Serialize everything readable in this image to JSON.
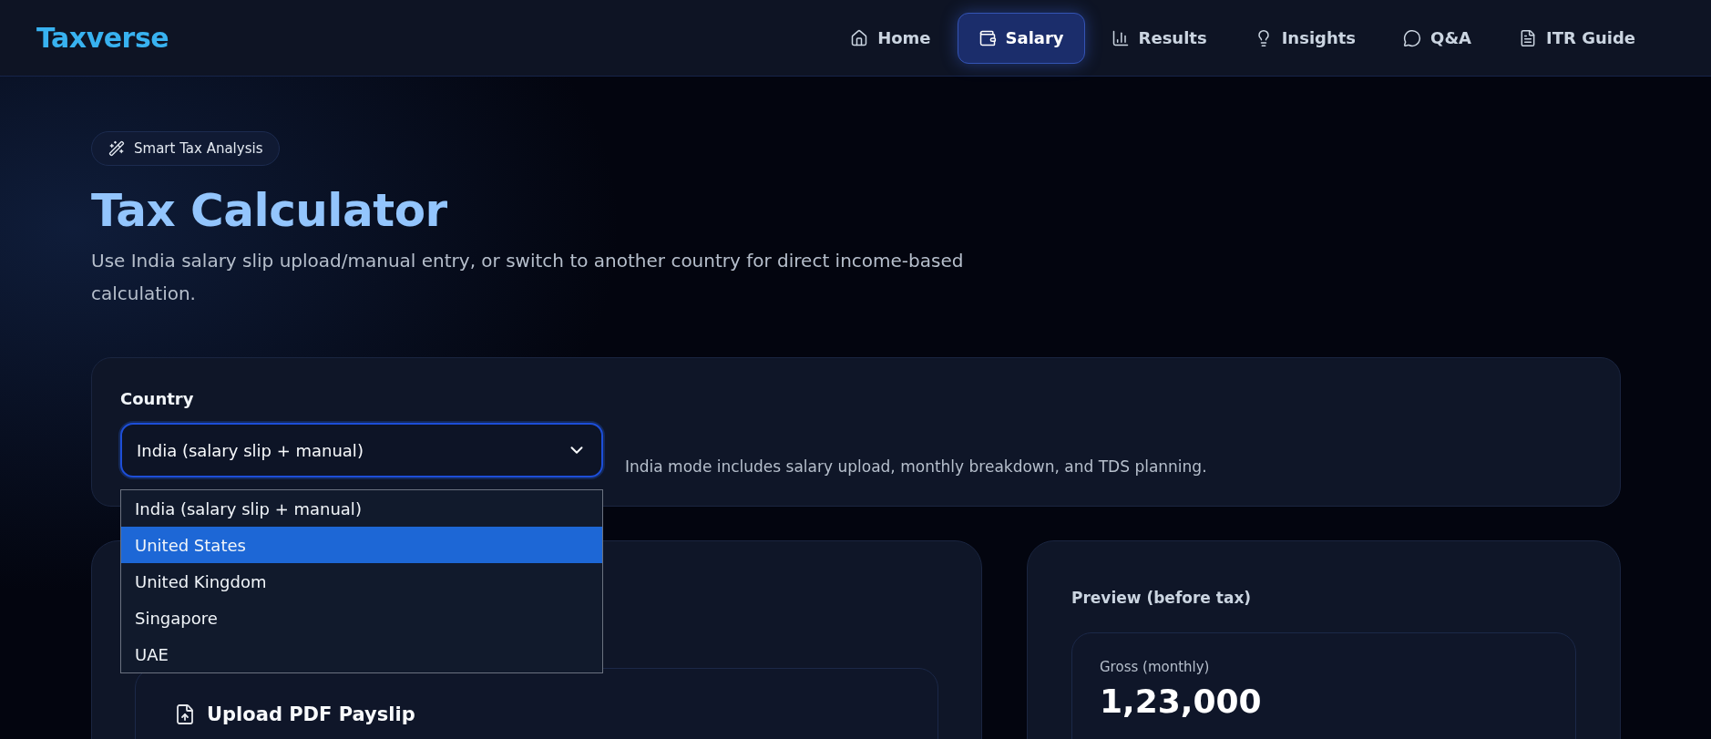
{
  "header": {
    "logo": "Taxverse",
    "nav": [
      {
        "label": "Home",
        "selected": false
      },
      {
        "label": "Salary",
        "selected": true
      },
      {
        "label": "Results",
        "selected": false
      },
      {
        "label": "Insights",
        "selected": false
      },
      {
        "label": "Q&A",
        "selected": false
      },
      {
        "label": "ITR Guide",
        "selected": false
      }
    ]
  },
  "hero": {
    "badge": "Smart Tax Analysis",
    "title": "Tax Calculator",
    "subtitle": "Use India salary slip upload/manual entry, or switch to another country for direct income-based calculation."
  },
  "country": {
    "label": "Country",
    "value": "India (salary slip + manual)",
    "open": true,
    "hint": "India mode includes salary upload, monthly breakdown, and TDS planning.",
    "options": [
      {
        "label": "India (salary slip + manual)",
        "highlighted": false
      },
      {
        "label": "United States",
        "highlighted": true
      },
      {
        "label": "United Kingdom",
        "highlighted": false
      },
      {
        "label": "Singapore",
        "highlighted": false
      },
      {
        "label": "UAE",
        "highlighted": false
      }
    ]
  },
  "upload": {
    "title": "Upload PDF Payslip"
  },
  "preview": {
    "title": "Preview (before tax)",
    "gross_label": "Gross (monthly)",
    "gross_value": "1,23,000"
  }
}
